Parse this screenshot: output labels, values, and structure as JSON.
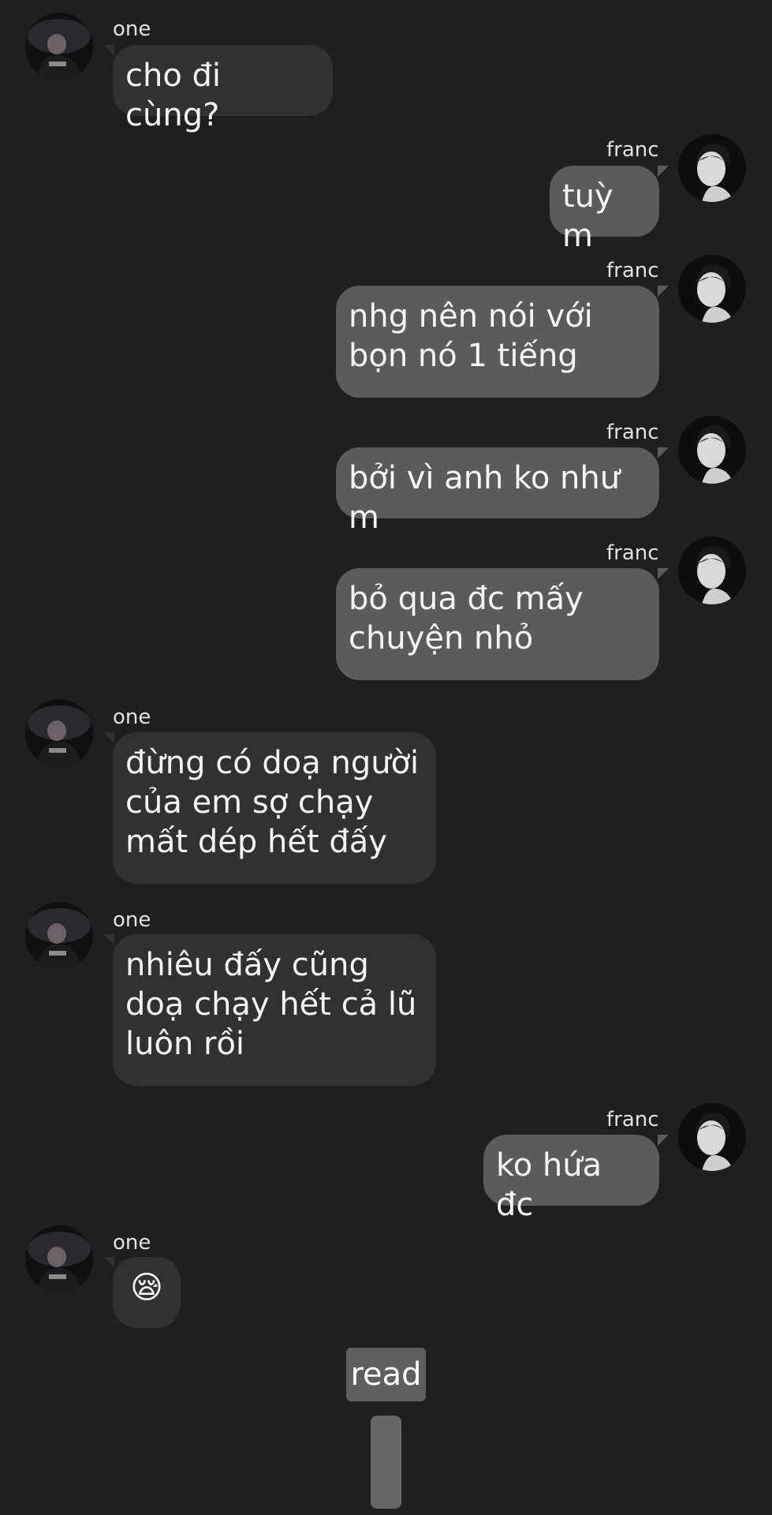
{
  "senders": {
    "other": {
      "name": "one",
      "avatar_icon": "dark-person-avatar-icon"
    },
    "self": {
      "name": "franc",
      "avatar_icon": "portrait-avatar-icon"
    }
  },
  "messages": [
    {
      "from": "one",
      "text": "cho đi cùng?"
    },
    {
      "from": "franc",
      "text": "tuỳ m"
    },
    {
      "from": "franc",
      "text": "nhg nên nói với\nbọn nó 1 tiếng"
    },
    {
      "from": "franc",
      "text": "bởi vì anh ko như m"
    },
    {
      "from": "franc",
      "text": "bỏ qua đc mấy\nchuyện nhỏ"
    },
    {
      "from": "one",
      "text": "đừng có doạ người\ncủa em sợ chạy\nmất dép hết đấy"
    },
    {
      "from": "one",
      "text": "nhiêu đấy cũng\ndoạ chạy hết cả lũ\nluôn rồi"
    },
    {
      "from": "franc",
      "text": "ko hứa đc"
    },
    {
      "from": "one",
      "text": "😪"
    }
  ],
  "status": {
    "read_label": "read"
  },
  "colors": {
    "background": "#1f1f1f",
    "incoming_bubble": "#313131",
    "outgoing_bubble": "#5b5b5b",
    "text": "#f5f5f5"
  }
}
